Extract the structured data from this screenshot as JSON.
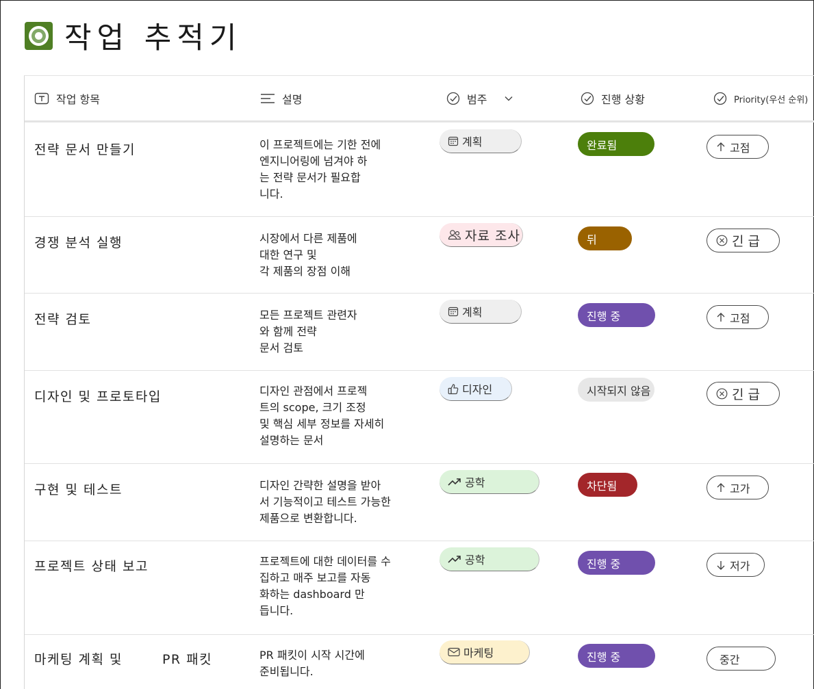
{
  "app": {
    "title": "작업 추적기",
    "icon": "target-icon",
    "accent": "#4f7f24"
  },
  "columns": {
    "task": {
      "label": "작업 항목",
      "icon": "text-field-icon"
    },
    "description": {
      "label": "설명",
      "icon": "multiline-text-icon"
    },
    "category": {
      "label": "범주",
      "icon": "choice-check-icon",
      "menu_icon": "chevron-down-icon"
    },
    "status": {
      "label": "진행 상황",
      "icon": "choice-check-icon"
    },
    "priority": {
      "label": "Priority(우선 순위)",
      "icon": "choice-check-icon"
    }
  },
  "rows": [
    {
      "task": "전략 문서 만들기",
      "description": "이 프로젝트에는 기한 전에\n엔지니어링에 넘겨야 하\n는 전략 문서가 필요합\n니다.",
      "category": "계획",
      "category_icon": "calendar-icon",
      "status": "완료됨",
      "status_color": "#4c7f0b",
      "priority": "고점",
      "priority_icon": "arrow-up-icon"
    },
    {
      "task": "경쟁 분석 실행",
      "description": "시장에서 다른 제품에\n대한 연구 및\n각 제품의 장점 이해",
      "category": "자료 조사",
      "category_icon": "people-icon",
      "status": "뒤",
      "status_color": "#9a6200",
      "priority": "긴 급",
      "priority_icon": "circle-x-icon"
    },
    {
      "task": "전략 검토",
      "description": "모든 프로젝트 관련자\n와 함께 전략\n문서 검토",
      "category": "계획",
      "category_icon": "calendar-icon",
      "status": "진행 중",
      "status_color": "#7050ad",
      "priority": "고점",
      "priority_icon": "arrow-up-icon"
    },
    {
      "task": "디자인 및 프로토타입",
      "description": "디자인 관점에서 프로젝\n트의 scope, 크기 조정\n및 핵심 세부 정보를 자세히\n설명하는 문서",
      "category": "디자인",
      "category_icon": "thumbs-up-icon",
      "status": "시작되지 않음",
      "status_color": "#e7e7e7",
      "priority": "긴 급",
      "priority_icon": "circle-x-icon"
    },
    {
      "task": "구현 및 테스트",
      "description": "디자인 간략한 설명을 받아\n서 기능적이고 테스트 가능한\n제품으로 변환합니다.",
      "category": "공학",
      "category_icon": "trend-up-icon",
      "status": "차단됨",
      "status_color": "#a3262a",
      "priority": "고가",
      "priority_icon": "arrow-up-icon"
    },
    {
      "task": "프로젝트 상태 보고",
      "description": "프로젝트에 대한 데이터를 수\n집하고 매주 보고를 자동\n화하는 dashboard 만\n듭니다.",
      "category": "공학",
      "category_icon": "trend-up-icon",
      "status": "진행 중",
      "status_color": "#7050ad",
      "priority": "저가",
      "priority_icon": "arrow-down-icon"
    },
    {
      "task_part1": "마케팅 계획 및",
      "task_part2": "PR 패킷",
      "description": "PR 패킷이 시작 시간에\n준비됩니다.",
      "category": "마케팅",
      "category_icon": "mail-icon",
      "status": "진행 중",
      "status_color": "#7050ad",
      "priority": "중간"
    }
  ]
}
